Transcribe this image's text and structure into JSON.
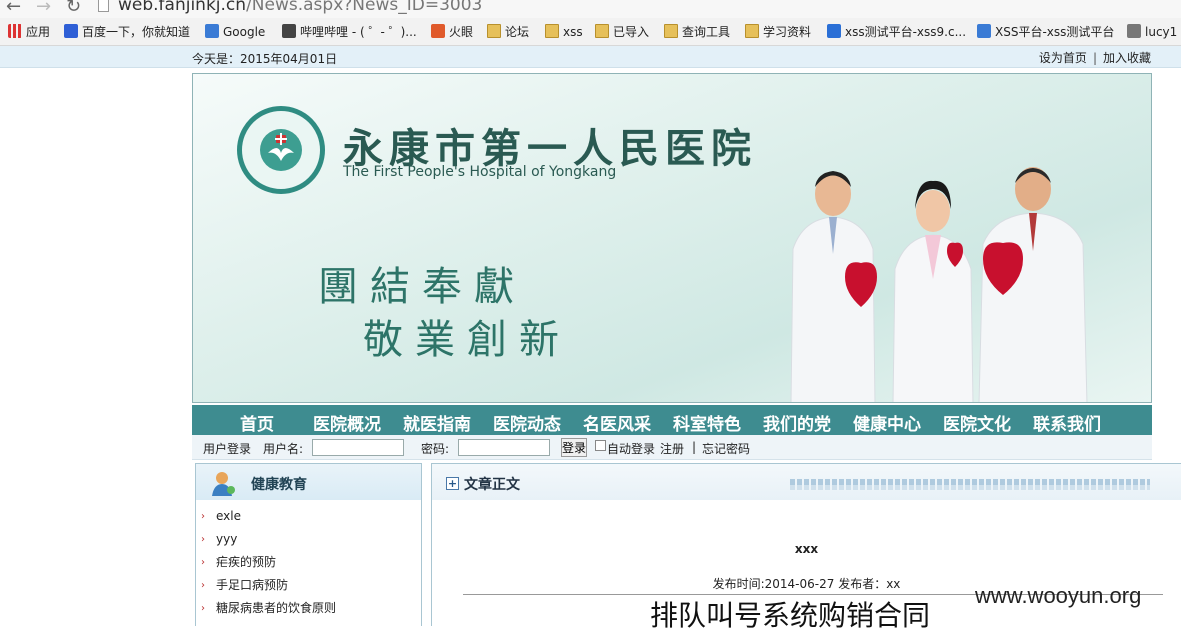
{
  "browser": {
    "url_host": "web.fanjinkj.cn",
    "url_path": "/News.aspx?News_ID=3003",
    "bookmarks": [
      {
        "label": "应用",
        "icon": "apps-grid-icon",
        "color": "#c0392b"
      },
      {
        "label": "百度一下，你就知道",
        "icon": "baidu-paw-icon",
        "color": "#2e5fd6"
      },
      {
        "label": "Google",
        "icon": "google-icon",
        "color": "#3a7bd5"
      },
      {
        "label": "哔哩哔哩 - ( ゜- ゜)...",
        "icon": "bilibili-tv-icon",
        "color": "#444"
      },
      {
        "label": "火眼",
        "icon": "fire-eye-icon",
        "color": "#e05a2b"
      },
      {
        "label": "论坛",
        "icon": "folder-icon"
      },
      {
        "label": "xss",
        "icon": "folder-icon"
      },
      {
        "label": "已导入",
        "icon": "folder-icon"
      },
      {
        "label": "查询工具",
        "icon": "folder-icon"
      },
      {
        "label": "学习资料",
        "icon": "folder-icon"
      },
      {
        "label": "xss测试平台-xss9.c...",
        "icon": "shield-icon",
        "color": "#2a6fd6"
      },
      {
        "label": "XSS平台-xss测试平台",
        "icon": "google-icon",
        "color": "#3a7bd5"
      },
      {
        "label": "lucy1",
        "icon": "star-icon",
        "color": "#777"
      }
    ]
  },
  "site": {
    "today_text": "今天是：2015年04月01日",
    "set_home": "设为首页",
    "add_favorite": "加入收藏",
    "separator": "|",
    "hospital_name_cn": "永康市第一人民医院",
    "hospital_name_en": "The First People's Hospital of Yongkang",
    "slogan_line1": "團結奉獻",
    "slogan_line2": "敬業創新",
    "nav": [
      "首页",
      "医院概况",
      "就医指南",
      "医院动态",
      "名医风采",
      "科室特色",
      "我们的党",
      "健康中心",
      "医院文化",
      "联系我们"
    ],
    "login": {
      "user_login": "用户登录",
      "username_label": "用户名:",
      "password_label": "密码:",
      "login_button": "登录",
      "auto_login": "自动登录",
      "register": "注册",
      "sep": "|",
      "forgot": "忘记密码"
    },
    "left_panel": {
      "title": "健康教育",
      "items": [
        "exle",
        "yyy",
        "疟疾的预防",
        "手足口病预防",
        "糖尿病患者的饮食原则"
      ]
    },
    "article": {
      "panel_title": "文章正文",
      "title": "xxx",
      "meta": "发布时间:2014-06-27 发布者：xx",
      "injected_text": "排队叫号系统购销合同"
    },
    "watermark": "www.wooyun.org"
  }
}
